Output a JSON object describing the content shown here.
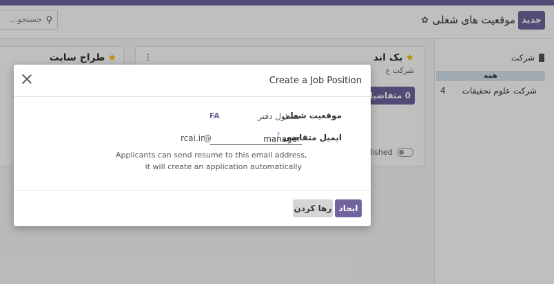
{
  "colors": {
    "brand": "#71639e",
    "topbar": "#71639e",
    "star": "#f3c000",
    "backdrop": "rgba(0,0,0,0.25)"
  },
  "control_panel": {
    "new_button_label": "جدید",
    "title": "موقعیت های شغلی",
    "search_placeholder": "جستجو..."
  },
  "side_panel": {
    "heading": "شرکت",
    "all_label": "همه",
    "items": [
      {
        "label": "شرکت علوم تحقیقات",
        "count": "4"
      }
    ]
  },
  "kanban": {
    "cards": [
      {
        "title": "بک اند",
        "subtitle": "شرکت ع",
        "applicants_label": "0 متقاضیان",
        "published_label": "lished"
      },
      {
        "title": "طراح سایت"
      }
    ]
  },
  "modal": {
    "title": "Create a Job Position",
    "job_label": "موقعیت شغلی",
    "job_value": "مسئول دفتر",
    "lang_tag": "FA",
    "email_label": "ایمیل متقاضی",
    "help_mark": "?",
    "email_value": "manager",
    "email_at": "@",
    "email_domain": "rcai.ir",
    "help_line1": "Applicants can send resume to this email address,",
    "help_line2": "it will create an application automatically",
    "create_label": "ایجاد",
    "discard_label": "رها کردن"
  }
}
